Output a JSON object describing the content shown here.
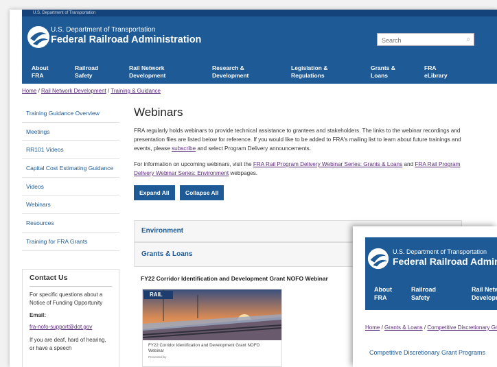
{
  "top_strip": "U.S. Department of Transportation",
  "header": {
    "dept": "U.S. Department of Transportation",
    "agency": "Federal Railroad Administration",
    "search_placeholder": "Search",
    "search_icon": "search-icon",
    "nav": [
      {
        "line1": "About",
        "line2": "FRA"
      },
      {
        "line1": "Railroad",
        "line2": "Safety"
      },
      {
        "line1": "Rail Network",
        "line2": "Development"
      },
      {
        "line1": "Research &",
        "line2": "Development"
      },
      {
        "line1": "Legislation &",
        "line2": "Regulations"
      },
      {
        "line1": "Grants &",
        "line2": "Loans"
      },
      {
        "line1": "FRA",
        "line2": "eLibrary"
      }
    ]
  },
  "breadcrumb": {
    "home": "Home",
    "sep": "/",
    "level1": "Rail Network Development",
    "level2": "Training & Guidance"
  },
  "sidebar": {
    "items": [
      "Training Guidance Overview",
      "Meetings",
      "RR101 Videos",
      "Capital Cost Estimating Guidance",
      "Videos",
      "Webinars",
      "Resources",
      "Training for FRA Grants"
    ]
  },
  "contact": {
    "title": "Contact Us",
    "intro": "For specific questions about a Notice of Funding Opportunity",
    "email_label": "Email:",
    "email": "fra-nofo-support@dot.gov",
    "deaf_text": "If you are deaf, hard of hearing, or have a speech"
  },
  "main": {
    "title": "Webinars",
    "p1_a": "FRA regularly holds webinars to provide technical assistance to grantees and stakeholders. The links to the webinar recordings and presentation files are listed below for reference.  If you would like to be added to FRA's mailing list to learn about future trainings and events, please ",
    "p1_link": "subscribe",
    "p1_b": " and select Program Delivery announcements.",
    "p2_a": "For information on upcoming webinars, visit the ",
    "p2_link1": "FRA Rail Program Delivery Webinar Series: Grants & Loans",
    "p2_b": " and ",
    "p2_link2": "FRA Rail Program Delivery Webinar Series: Environment",
    "p2_c": " webpages.",
    "expand_all": "Expand All",
    "collapse_all": "Collapse All"
  },
  "accordions": {
    "environment": "Environment",
    "grants_loans": "Grants & Loans",
    "chevron_icon": "chevron-down-icon"
  },
  "webinar": {
    "heading": "FY22 Corridor Identification and Development Grant NOFO Webinar",
    "thumb_banner": "RAIL",
    "caption": "FY22 Corridor Identification and Development Grant NOFO Webinar",
    "author": "Presented by"
  },
  "overlay": {
    "dept": "U.S. Department of Transportation",
    "agency": "Federal Railroad Administration",
    "nav": [
      {
        "line1": "About",
        "line2": "FRA"
      },
      {
        "line1": "Railroad",
        "line2": "Safety"
      },
      {
        "line1": "Rail Network",
        "line2": "Development"
      }
    ],
    "breadcrumb": {
      "home": "Home",
      "sep": "/",
      "level1": "Grants & Loans",
      "level2": "Competitive Discretionary Grant Programs"
    },
    "side_item": "Competitive Discretionary Grant Programs"
  }
}
